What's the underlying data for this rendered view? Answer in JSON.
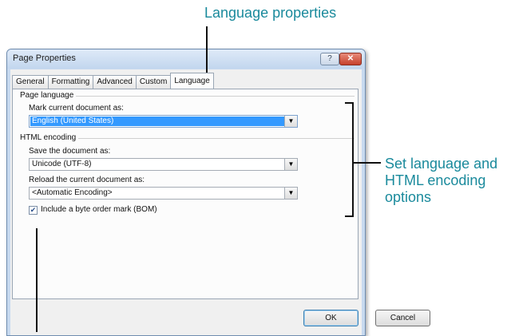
{
  "callouts": {
    "top": "Language properties",
    "right": "Set language and HTML encoding options"
  },
  "dialog": {
    "title": "Page Properties",
    "help_label": "?",
    "close_label": "✕"
  },
  "tabs": [
    {
      "label": "General"
    },
    {
      "label": "Formatting"
    },
    {
      "label": "Advanced"
    },
    {
      "label": "Custom"
    },
    {
      "label": "Language",
      "active": true
    }
  ],
  "page_language": {
    "group_title": "Page language",
    "mark_label": "Mark current document as:",
    "mark_value": "English (United States)"
  },
  "html_encoding": {
    "group_title": "HTML encoding",
    "save_label": "Save the document as:",
    "save_value": "Unicode (UTF-8)",
    "reload_label": "Reload the current document as:",
    "reload_value": "<Automatic Encoding>",
    "bom_label": "Include a byte order mark (BOM)",
    "bom_checked": true
  },
  "buttons": {
    "ok": "OK",
    "cancel": "Cancel"
  },
  "colors": {
    "callout_text": "#1a8a9c",
    "selection": "#3399ff"
  }
}
